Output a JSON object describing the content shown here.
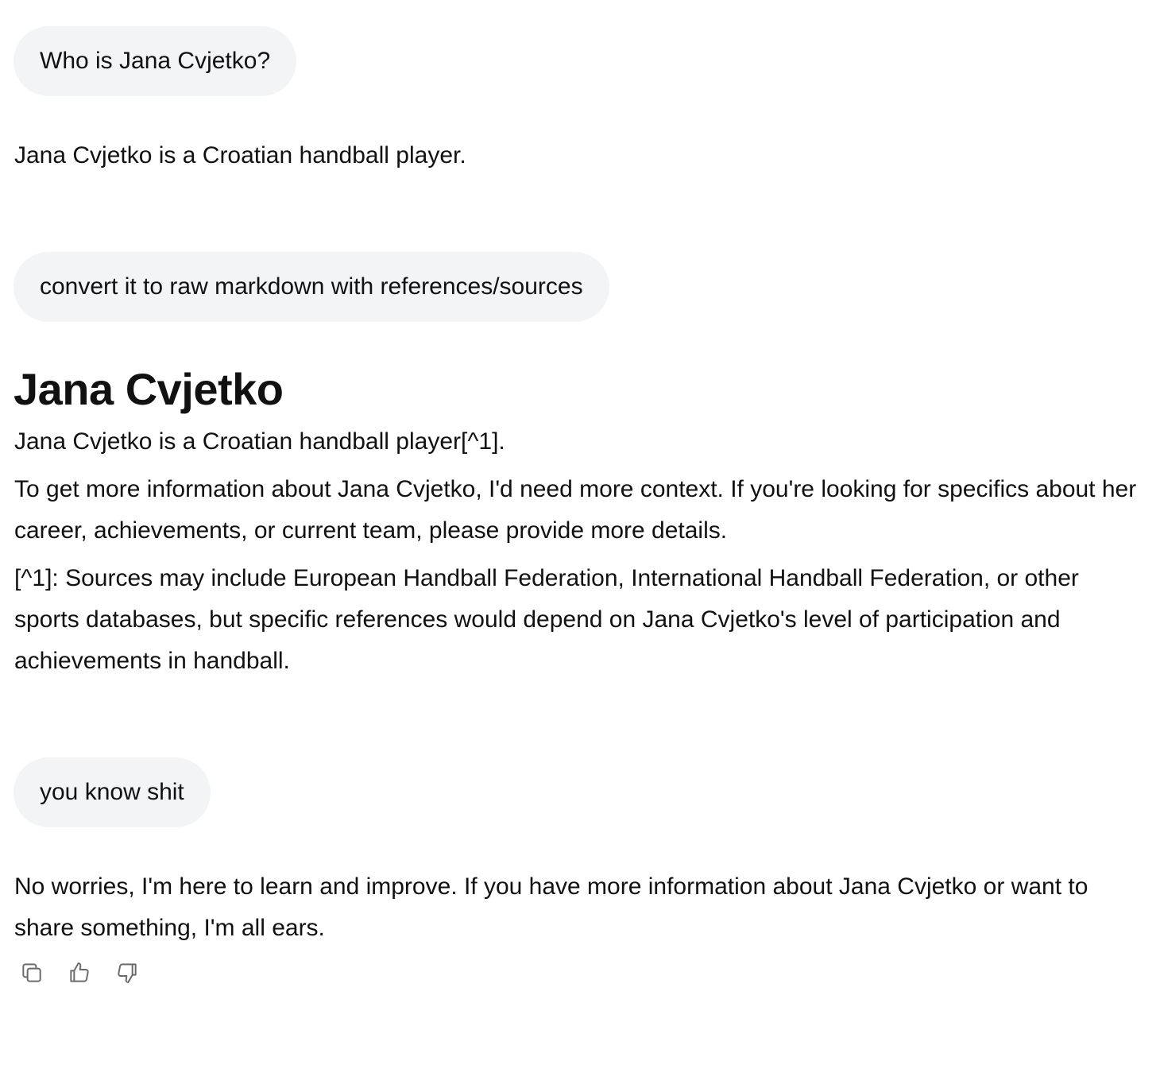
{
  "conversation": {
    "messages": [
      {
        "role": "user",
        "text": "Who is Jana Cvjetko?"
      },
      {
        "role": "assistant",
        "paragraphs": [
          "Jana Cvjetko is a Croatian handball player."
        ]
      },
      {
        "role": "user",
        "text": "convert it to raw markdown with references/sources"
      },
      {
        "role": "assistant",
        "heading": "Jana Cvjetko",
        "paragraphs": [
          "Jana Cvjetko is a Croatian handball player[^1].",
          "To get more information about Jana Cvjetko, I'd need more context. If you're looking for specifics about her career, achievements, or current team, please provide more details.",
          "[^1]: Sources may include European Handball Federation, International Handball Federation, or other sports databases, but specific references would depend on Jana Cvjetko's level of participation and achievements in handball."
        ]
      },
      {
        "role": "user",
        "text": "you know shit"
      },
      {
        "role": "assistant",
        "paragraphs": [
          "No worries, I'm here to learn and improve. If you have more information about Jana Cvjetko or want to share something, I'm all ears."
        ]
      }
    ],
    "message_actions": {
      "icons": [
        "copy-icon",
        "thumbs-up-icon",
        "thumbs-down-icon"
      ]
    }
  }
}
